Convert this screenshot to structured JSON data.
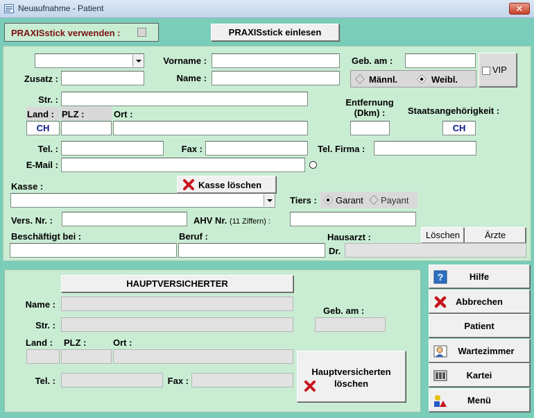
{
  "window": {
    "title": "Neuaufnahme - Patient",
    "close": "✕"
  },
  "stick": {
    "use_label": "PRAXISstick verwenden :",
    "read_button": "PRAXISstick einlesen"
  },
  "patient": {
    "vorname_label": "Vorname :",
    "zusatz_label": "Zusatz :",
    "name_label": "Name :",
    "geb_label": "Geb. am :",
    "gender_male": "Männl.",
    "gender_female": "Weibl.",
    "vip_label": "VIP",
    "str_label": "Str. :",
    "land_label": "Land :",
    "plz_label": "PLZ :",
    "ort_label": "Ort :",
    "land_value": "CH",
    "distance_label_1": "Entfernung",
    "distance_label_2": "(Dkm) :",
    "nationality_label": "Staatsangehörigkeit :",
    "nationality_value": "CH",
    "tel_label": "Tel. :",
    "fax_label": "Fax :",
    "tel_firma_label": "Tel. Firma :",
    "email_label": "E-Mail :",
    "kasse_label": "Kasse :",
    "kasse_delete": "Kasse löschen",
    "tiers_label": "Tiers :",
    "tiers_garant": "Garant",
    "tiers_payant": "Payant",
    "vers_label": "Vers. Nr. :",
    "ahv_label": "AHV Nr.",
    "ahv_hint": "(11 Ziffern) :",
    "employer_label": "Beschäftigt bei :",
    "beruf_label": "Beruf :",
    "hausarzt_label": "Hausarzt :",
    "dr_label": "Dr.",
    "loeschen_button": "Löschen",
    "aerzte_button": "Ärzte"
  },
  "insured": {
    "header_button": "HAUPTVERSICHERTER",
    "name_label": "Name :",
    "geb_label": "Geb. am :",
    "str_label": "Str. :",
    "land_label": "Land :",
    "plz_label": "PLZ :",
    "ort_label": "Ort :",
    "tel_label": "Tel. :",
    "fax_label": "Fax :",
    "delete_line1": "Hauptversicherten",
    "delete_line2": "löschen"
  },
  "sidebar": {
    "hilfe": "Hilfe",
    "abbrechen": "Abbrechen",
    "patient": "Patient",
    "wartezimmer": "Wartezimmer",
    "kartei": "Kartei",
    "menu": "Menü"
  },
  "colors": {
    "background": "#79cdb9",
    "panel": "#c9edd3",
    "delete_red": "#c8141e",
    "code_blue": "#0a1a86"
  }
}
